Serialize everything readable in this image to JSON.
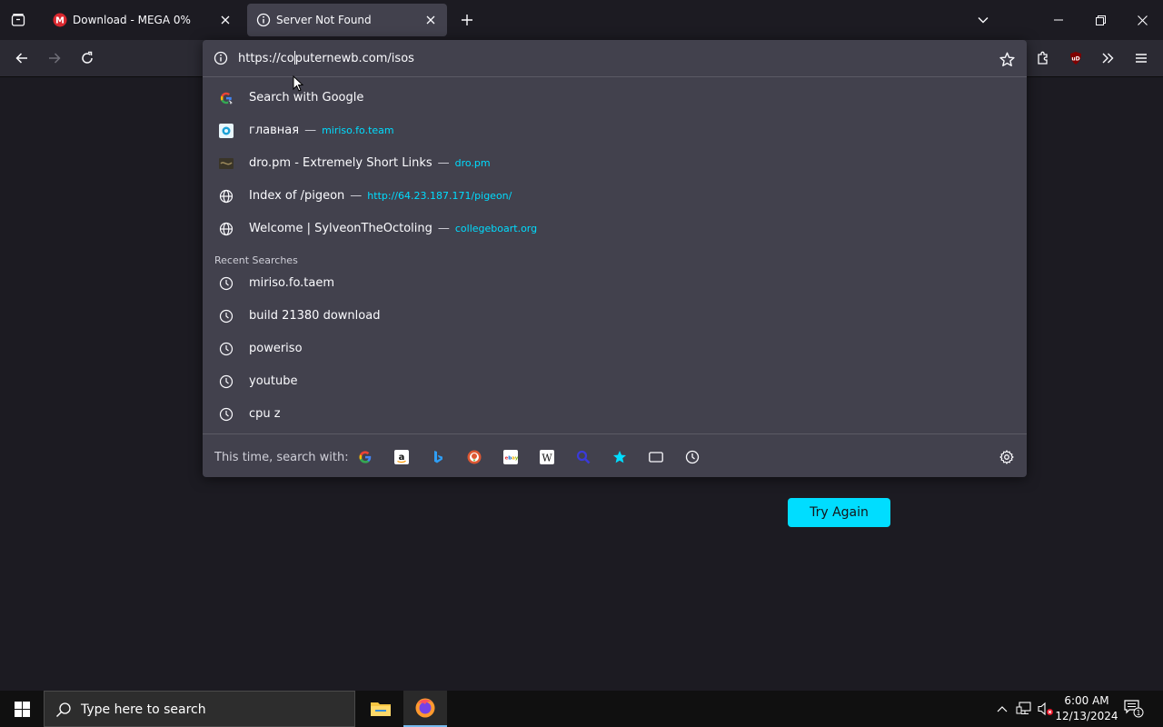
{
  "tabs": [
    {
      "title": "Download - MEGA 0%",
      "icon": "mega-icon",
      "active": false
    },
    {
      "title": "Server Not Found",
      "icon": "info-icon",
      "active": true
    }
  ],
  "urlbar": {
    "value_before_caret": "https://co",
    "value_after_caret": "puternewb.com/isos"
  },
  "results": [
    {
      "icon": "google-search-icon",
      "text": "Search with Google",
      "url": ""
    },
    {
      "icon": "site-favicon",
      "text": "главная",
      "url": "miriso.fo.team"
    },
    {
      "icon": "site-favicon",
      "text": "dro.pm - Extremely Short Links",
      "url": "dro.pm"
    },
    {
      "icon": "globe-icon",
      "text": "Index of /pigeon",
      "url": "http://64.23.187.171/pigeon/"
    },
    {
      "icon": "globe-icon",
      "text": "Welcome | SylveonTheOctoling",
      "url": "collegeboart.org"
    }
  ],
  "recent_searches_label": "Recent Searches",
  "recent_searches": [
    "miriso.fo.taem",
    "build 21380 download",
    "poweriso",
    "youtube",
    "cpu z"
  ],
  "oneoff": {
    "label": "This time, search with:",
    "engines": [
      "google",
      "amazon",
      "bing",
      "duckduckgo",
      "ebay",
      "wikipedia",
      "search",
      "bookmarks",
      "tabs",
      "history"
    ]
  },
  "page": {
    "try_again": "Try Again"
  },
  "taskbar": {
    "search_placeholder": "Type here to search",
    "time": "6:00 AM",
    "date": "12/13/2024",
    "notification_count": "1"
  },
  "colors": {
    "accent": "#00ddff",
    "popup_bg": "#42414d",
    "page_bg": "#1c1b22"
  }
}
